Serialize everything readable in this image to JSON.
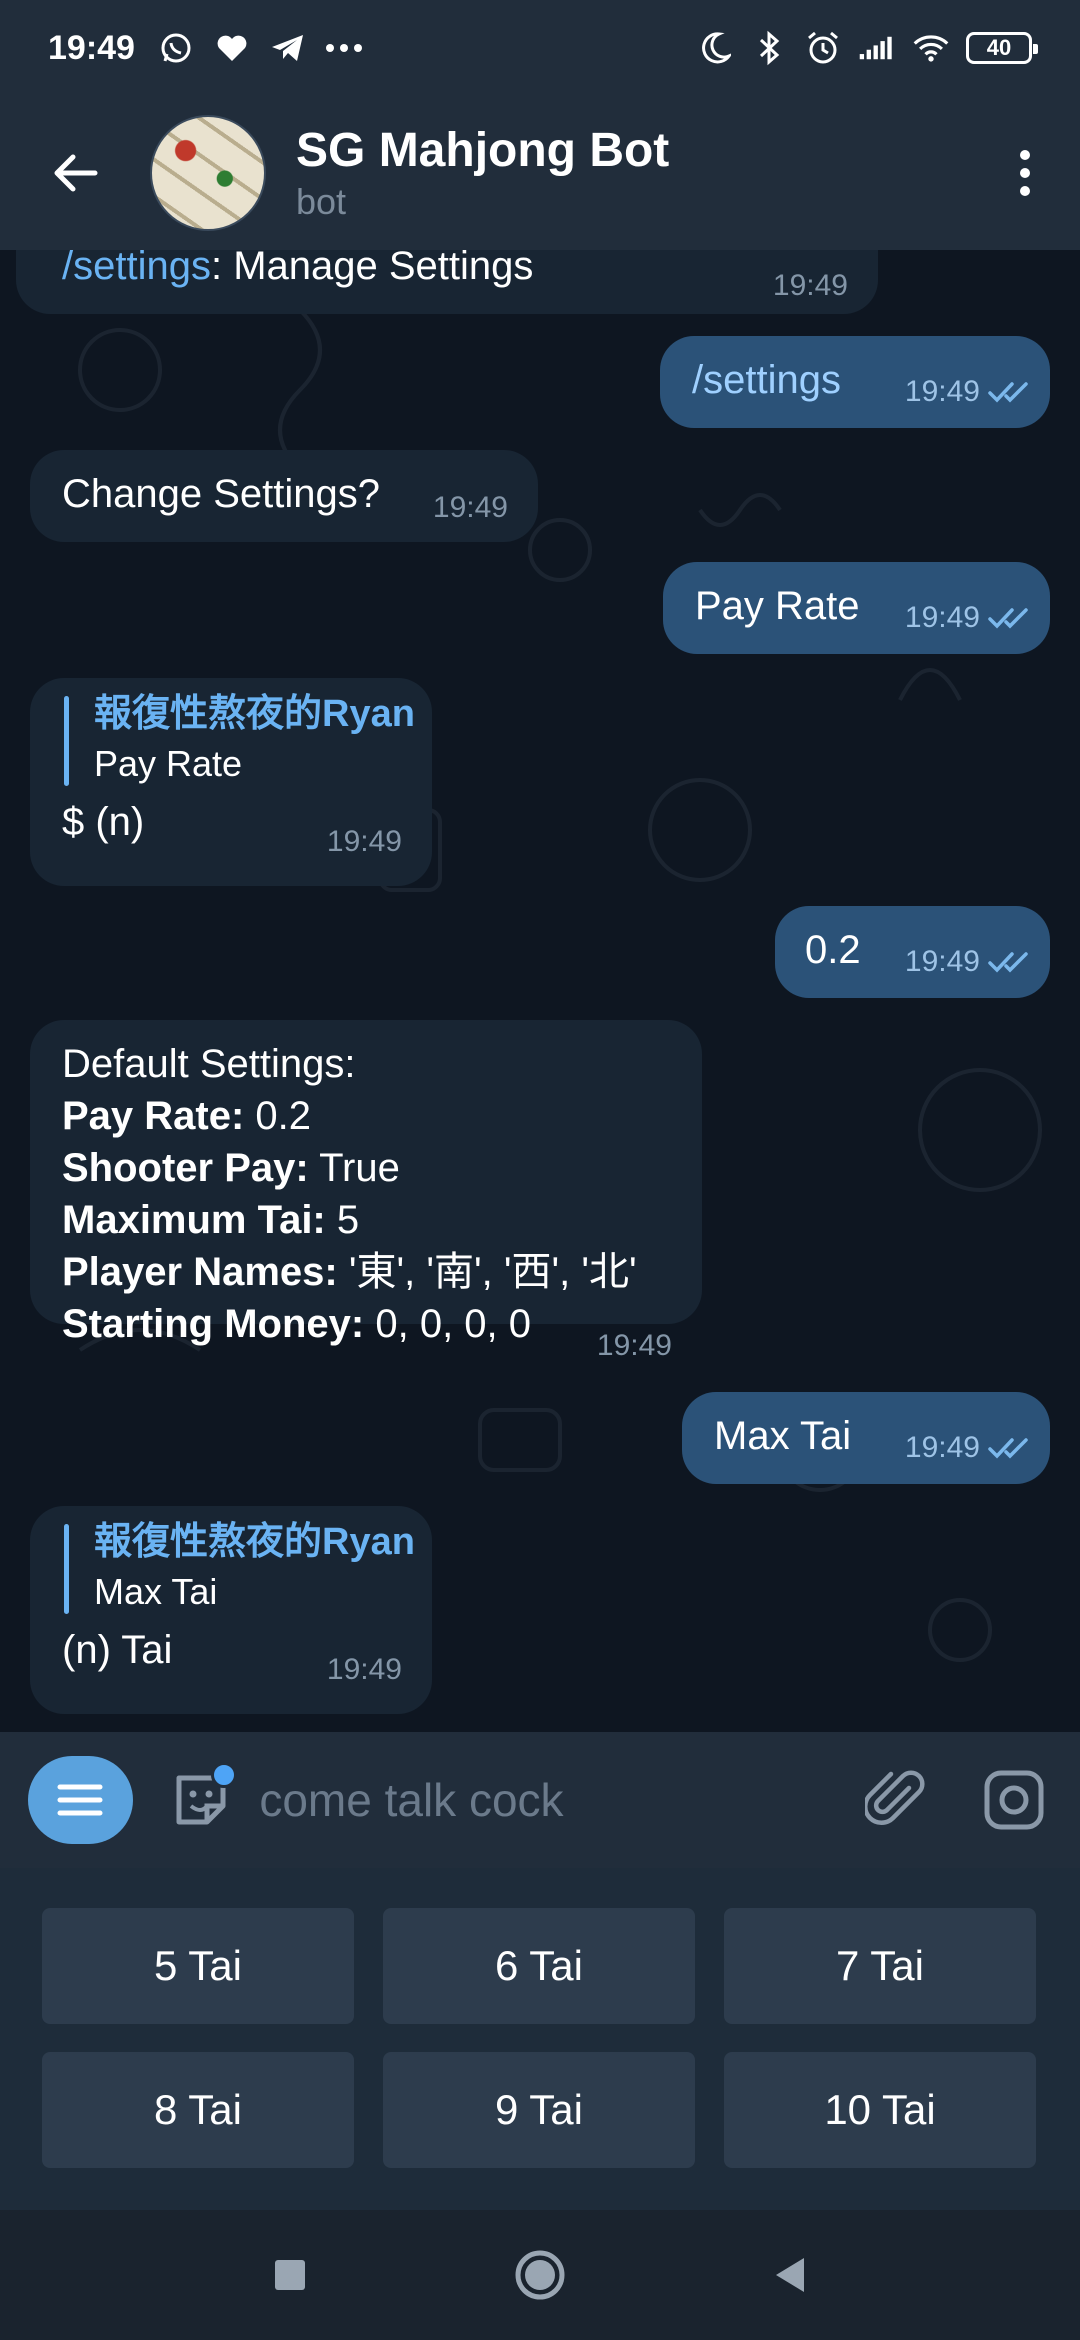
{
  "status_bar": {
    "time": "19:49",
    "battery": "40",
    "left_icons": [
      "whatsapp-icon",
      "heart-icon",
      "telegram-icon",
      "more-dots-icon"
    ],
    "right_icons": [
      "moon-icon",
      "bluetooth-icon",
      "alarm-icon",
      "signal-icon",
      "wifi-icon",
      "battery-icon"
    ]
  },
  "header": {
    "title": "SG Mahjong Bot",
    "subtitle": "bot"
  },
  "messages": [
    {
      "dir": "in",
      "cmd": "/settings",
      "text": ": Manage Settings",
      "time": "19:49"
    },
    {
      "dir": "out",
      "cmd": "/settings",
      "time": "19:49",
      "read": true
    },
    {
      "dir": "in",
      "text": "Change Settings?",
      "time": "19:49"
    },
    {
      "dir": "out",
      "text": "Pay Rate",
      "time": "19:49",
      "read": true
    },
    {
      "dir": "in",
      "reply_name": "報復性熬夜的Ryan",
      "reply_text": "Pay Rate",
      "text": "$ (n)",
      "time": "19:49"
    },
    {
      "dir": "out",
      "text": "0.2",
      "time": "19:49",
      "read": true
    },
    {
      "dir": "in",
      "heading": "Default Settings:",
      "lines": [
        {
          "label": "Pay Rate:",
          "value": " 0.2"
        },
        {
          "label": "Shooter Pay:",
          "value": " True"
        },
        {
          "label": "Maximum Tai:",
          "value": " 5"
        },
        {
          "label": "Player Names:",
          "value": " '東', '南', '西', '北'"
        },
        {
          "label": "Starting Money:",
          "value": " 0, 0, 0, 0"
        }
      ],
      "time": "19:49"
    },
    {
      "dir": "out",
      "text": "Max Tai",
      "time": "19:49",
      "read": true
    },
    {
      "dir": "in",
      "reply_name": "報復性熬夜的Ryan",
      "reply_text": "Max Tai",
      "text": "(n) Tai",
      "time": "19:49"
    }
  ],
  "composer": {
    "placeholder": "come talk cock"
  },
  "keyboard": [
    [
      "5 Tai",
      "6 Tai",
      "7 Tai"
    ],
    [
      "8 Tai",
      "9 Tai",
      "10 Tai"
    ]
  ],
  "colors": {
    "header_bg": "#212d3b",
    "chat_bg": "#0e1621",
    "incoming_bubble": "#182533",
    "outgoing_bubble": "#2b5278",
    "accent": "#6ab3f3",
    "keyboard_button": "#2d3c4d"
  }
}
